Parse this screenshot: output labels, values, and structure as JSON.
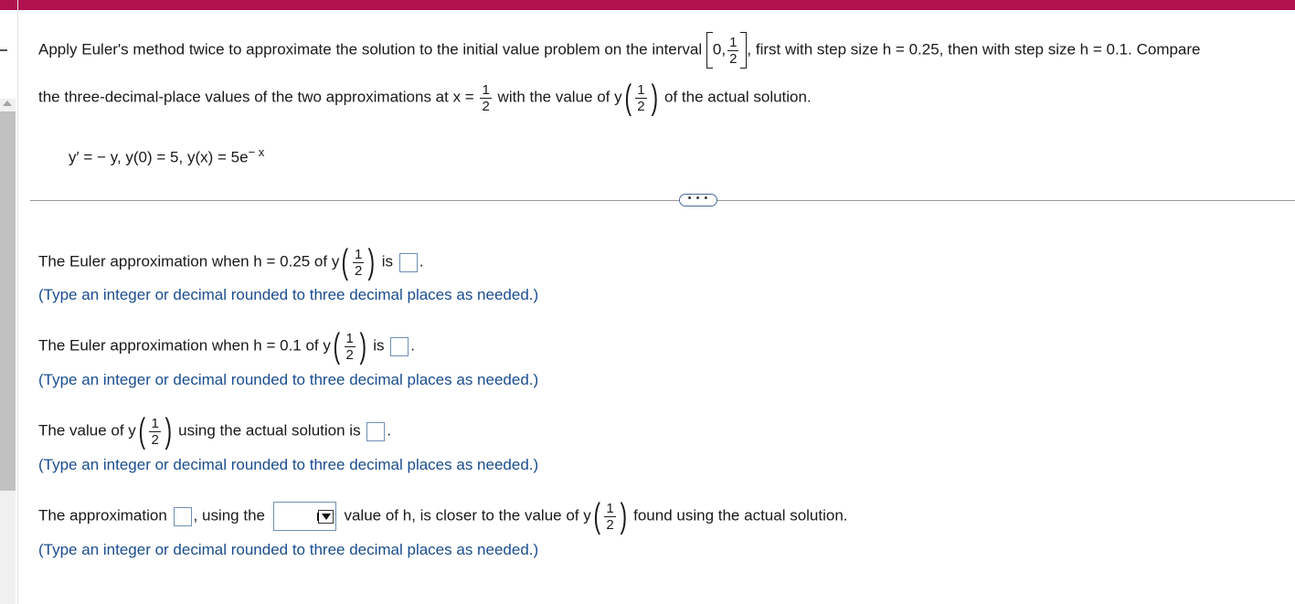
{
  "problem": {
    "line1_prefix": "Apply Euler's method twice to approximate the solution to the initial value problem on the interval",
    "interval_left": "0,",
    "interval_right_num": "1",
    "interval_right_den": "2",
    "line1_suffix": ", first with step size h = 0.25, then with step size h = 0.1. Compare",
    "line2_prefix": "the three-decimal-place values of the two approximations at x =",
    "x_num": "1",
    "x_den": "2",
    "line2_mid": "with the value of y",
    "y_num": "1",
    "y_den": "2",
    "line2_suffix": "of the actual solution.",
    "equation": "y′ = − y, y(0) = 5, y(x) = 5e",
    "equation_exp": "− x"
  },
  "more_button_label": "• • •",
  "q1": {
    "prefix": "The Euler approximation when h = 0.25 of y",
    "num": "1",
    "den": "2",
    "mid": "is",
    "suffix": ".",
    "hint": "(Type an integer or decimal rounded to three decimal places as needed.)"
  },
  "q2": {
    "prefix": "The Euler approximation when h = 0.1 of y",
    "num": "1",
    "den": "2",
    "mid": "is",
    "suffix": ".",
    "hint": "(Type an integer or decimal rounded to three decimal places as needed.)"
  },
  "q3": {
    "prefix": "The value of y",
    "num": "1",
    "den": "2",
    "mid": "using the actual solution is",
    "suffix": ".",
    "hint": "(Type an integer or decimal rounded to three decimal places as needed.)"
  },
  "q4": {
    "prefix": "The approximation",
    "mid1": ", using the",
    "mid2": "value of h, is closer to the value of y",
    "num": "1",
    "den": "2",
    "suffix": "found using the actual solution.",
    "hint": "(Type an integer or decimal rounded to three decimal places as needed.)"
  },
  "colors": {
    "top_bar": "#b0124f",
    "hint_text": "#1a4d8f",
    "input_border": "#6f8fb6"
  }
}
